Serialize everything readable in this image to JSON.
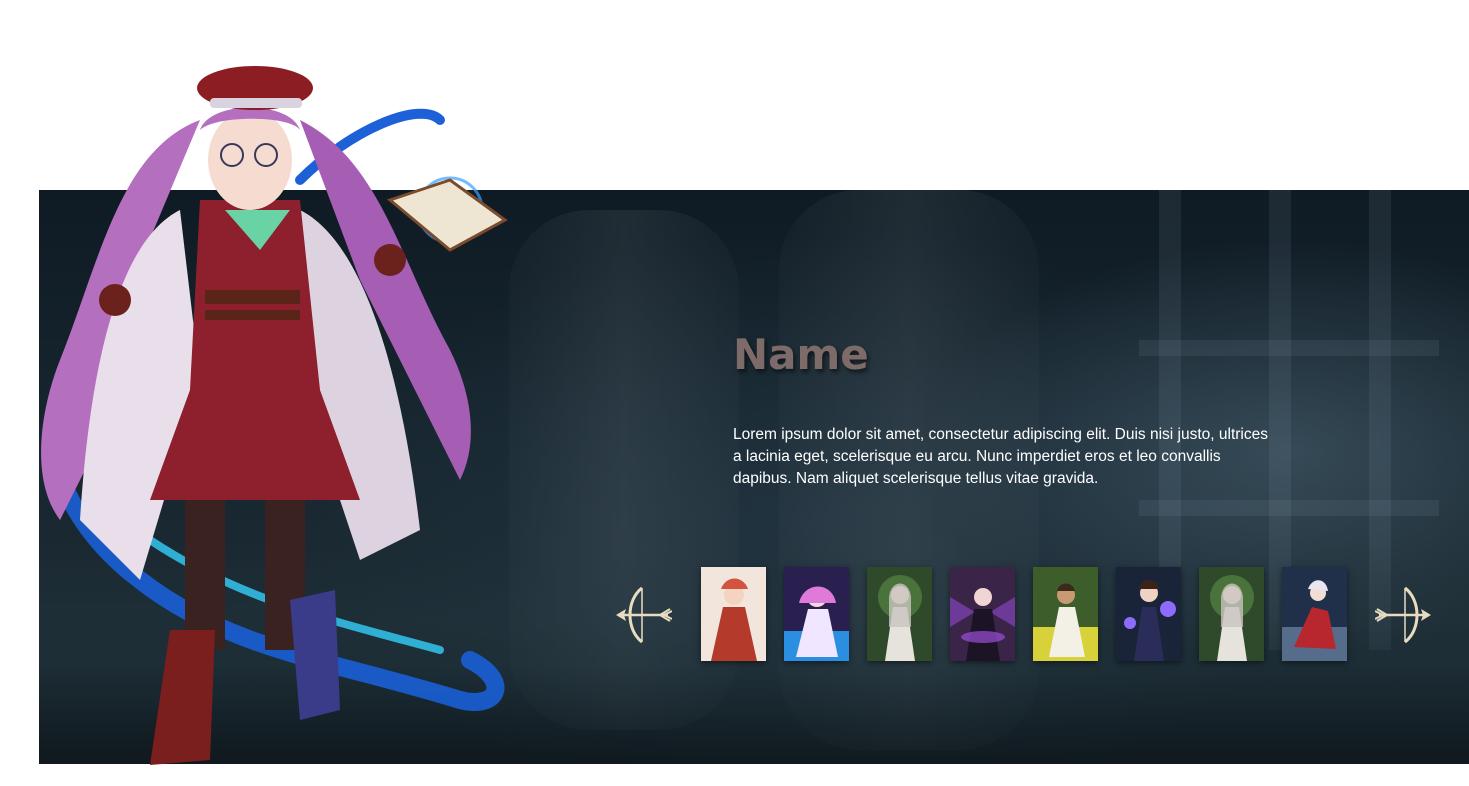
{
  "character": {
    "name": "Name",
    "description": "Lorem ipsum dolor sit amet, consectetur adipiscing elit. Duis nisi justo, ultrices a lacinia eget, scelerisque eu arcu. Nunc imperdiet eros et leo convallis dapibus. Nam aliquet scelerisque tellus vitae gravida."
  },
  "navigation": {
    "prev_icon": "bow-arrow-left-icon",
    "next_icon": "bow-arrow-right-icon"
  },
  "thumbnails": [
    {
      "icon": "character-portrait-1"
    },
    {
      "icon": "character-portrait-2"
    },
    {
      "icon": "character-portrait-3"
    },
    {
      "icon": "character-portrait-4"
    },
    {
      "icon": "character-portrait-5"
    },
    {
      "icon": "character-portrait-6"
    },
    {
      "icon": "character-portrait-7"
    },
    {
      "icon": "character-portrait-8"
    }
  ],
  "colors": {
    "panel_bg": "#17262f",
    "name_text": "#7d6b6a",
    "description_text": "#ffffff",
    "arrow": "#e8dcc0"
  }
}
